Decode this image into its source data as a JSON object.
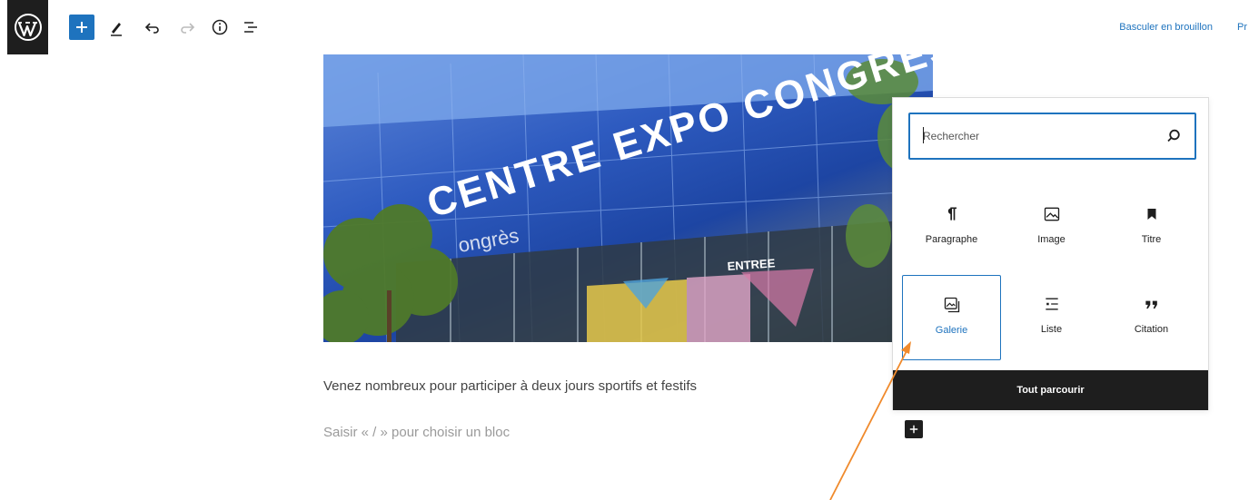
{
  "toolbar": {
    "draft_label": "Basculer en brouillon",
    "preview_label_cut": "Pr"
  },
  "image_block": {
    "sign_text": "CENTRE EXPO CONGRES",
    "sub_sign_text": "ongrès",
    "entry_text": "ENTREE"
  },
  "content": {
    "paragraph": "Venez nombreux pour participer à deux jours sportifs et festifs",
    "placeholder": "Saisir « / » pour choisir un bloc"
  },
  "inserter": {
    "search_placeholder": "Rechercher",
    "blocks": [
      {
        "label": "Paragraphe",
        "icon": "paragraph-icon"
      },
      {
        "label": "Image",
        "icon": "image-icon"
      },
      {
        "label": "Titre",
        "icon": "heading-bookmark-icon"
      },
      {
        "label": "Galerie",
        "icon": "gallery-icon"
      },
      {
        "label": "Liste",
        "icon": "list-icon"
      },
      {
        "label": "Citation",
        "icon": "quote-icon"
      }
    ],
    "selected_block": "Galerie",
    "browse_all_label": "Tout parcourir"
  },
  "colors": {
    "accent": "#1e73be",
    "dark": "#1e1e1e",
    "annotation_arrow": "#f08a2c"
  }
}
